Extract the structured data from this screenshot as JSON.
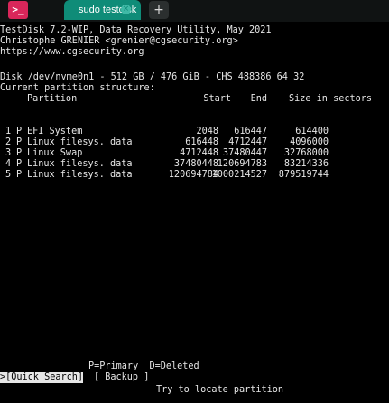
{
  "tabbar": {
    "app_icon_glyph": ">_",
    "tab_title": "sudo testdisk",
    "tab_close_glyph": "×",
    "new_tab_glyph": "+",
    "colors": {
      "tab": "#0f8c78",
      "app_icon": "#d9265a"
    }
  },
  "header": {
    "line1": "TestDisk 7.2-WIP, Data Recovery Utility, May 2021",
    "line2": "Christophe GRENIER <grenier@cgsecurity.org>",
    "line3": "https://www.cgsecurity.org"
  },
  "disk": {
    "info": "Disk /dev/nvme0n1 - 512 GB / 476 GiB - CHS 488386 64 32",
    "structure_label": "Current partition structure:"
  },
  "table": {
    "headers": {
      "partition": "Partition",
      "start": "Start",
      "end": "End",
      "size": "Size in sectors"
    },
    "rows": [
      {
        "num": "1",
        "type": "P",
        "name": "EFI System",
        "start": "2048",
        "end": "616447",
        "size": "614400"
      },
      {
        "num": "2",
        "type": "P",
        "name": "Linux filesys. data",
        "start": "616448",
        "end": "4712447",
        "size": "4096000"
      },
      {
        "num": "3",
        "type": "P",
        "name": "Linux Swap",
        "start": "4712448",
        "end": "37480447",
        "size": "32768000"
      },
      {
        "num": "4",
        "type": "P",
        "name": "Linux filesys. data",
        "start": "37480448",
        "end": "120694783",
        "size": "83214336"
      },
      {
        "num": "5",
        "type": "P",
        "name": "Linux filesys. data",
        "start": "120694784",
        "end": "1000214527",
        "size": "879519744"
      }
    ]
  },
  "footer": {
    "legend": "P=Primary  D=Deleted",
    "quick_search": ">[Quick Search]",
    "backup": "[ Backup ]",
    "hint": "Try to locate partition"
  }
}
